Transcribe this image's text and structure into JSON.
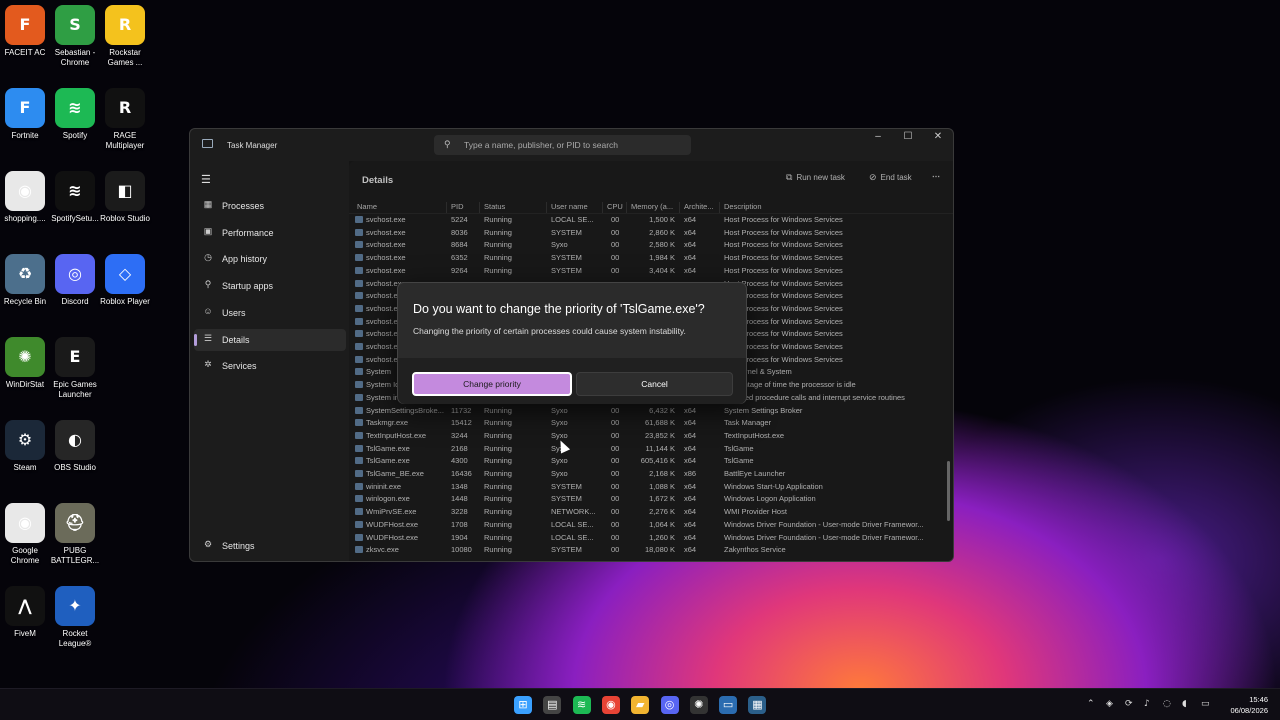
{
  "desktop_icons": [
    {
      "label": "FACEIT AC",
      "icon": "faceit-icon",
      "color": "#e35a1e",
      "glyph": "F"
    },
    {
      "label": "Sebastian - Chrome",
      "icon": "chrome-profile-icon",
      "color": "#2f9e44",
      "glyph": "S"
    },
    {
      "label": "Rockstar Games ...",
      "icon": "rockstar-icon",
      "color": "#f4c21d",
      "glyph": "R"
    },
    {
      "label": "Fortnite",
      "icon": "fortnite-icon",
      "color": "#2d8cf0",
      "glyph": "F"
    },
    {
      "label": "Spotify",
      "icon": "spotify-icon",
      "color": "#1db954",
      "glyph": "≋"
    },
    {
      "label": "RAGE Multiplayer",
      "icon": "rage-mp-icon",
      "color": "#111111",
      "glyph": "R"
    },
    {
      "label": "shopping....",
      "icon": "chrome-icon",
      "color": "#e8e8e8",
      "glyph": "◉"
    },
    {
      "label": "SpotifySetu...",
      "icon": "spotify-setup-icon",
      "color": "#101010",
      "glyph": "≋"
    },
    {
      "label": "Roblox Studio",
      "icon": "roblox-studio-icon",
      "color": "#1b1b1b",
      "glyph": "◧"
    },
    {
      "label": "Recycle Bin",
      "icon": "recycle-bin-icon",
      "color": "#4c6f8c",
      "glyph": "♻"
    },
    {
      "label": "Discord",
      "icon": "discord-icon",
      "color": "#5865f2",
      "glyph": "◎"
    },
    {
      "label": "Roblox Player",
      "icon": "roblox-player-icon",
      "color": "#2d6ef5",
      "glyph": "◇"
    },
    {
      "label": "WinDirStat",
      "icon": "windirstat-icon",
      "color": "#3f8a2c",
      "glyph": "✺"
    },
    {
      "label": "Epic Games Launcher",
      "icon": "epic-games-icon",
      "color": "#1a1a1a",
      "glyph": "E"
    },
    {
      "label": "Steam",
      "icon": "steam-icon",
      "color": "#1b2838",
      "glyph": "⚙"
    },
    {
      "label": "OBS Studio",
      "icon": "obs-icon",
      "color": "#262626",
      "glyph": "◐"
    },
    {
      "label": "Google Chrome",
      "icon": "chrome-icon",
      "color": "#e8e8e8",
      "glyph": "◉"
    },
    {
      "label": "PUBG BATTLEGR...",
      "icon": "pubg-icon",
      "color": "#6b6b5a",
      "glyph": "⛑"
    },
    {
      "label": "FiveM",
      "icon": "fivem-icon",
      "color": "#111111",
      "glyph": "⋀"
    },
    {
      "label": "Rocket League®",
      "icon": "rocket-league-icon",
      "color": "#1f5fbf",
      "glyph": "✦"
    }
  ],
  "task_manager": {
    "title": "Task Manager",
    "search_placeholder": "Type a name, publisher, or PID to search",
    "nav": [
      {
        "label": "Processes",
        "icon": "processes-icon",
        "glyph": "▦"
      },
      {
        "label": "Performance",
        "icon": "performance-icon",
        "glyph": "▣"
      },
      {
        "label": "App history",
        "icon": "app-history-icon",
        "glyph": "◷"
      },
      {
        "label": "Startup apps",
        "icon": "startup-apps-icon",
        "glyph": "⚲"
      },
      {
        "label": "Users",
        "icon": "users-icon",
        "glyph": "☺"
      },
      {
        "label": "Details",
        "icon": "details-icon",
        "glyph": "☰"
      },
      {
        "label": "Services",
        "icon": "services-icon",
        "glyph": "✲"
      }
    ],
    "settings_label": "Settings",
    "page_title": "Details",
    "run_task_label": "Run new task",
    "end_task_label": "End task",
    "columns": [
      "Name",
      "PID",
      "Status",
      "User name",
      "CPU",
      "Memory (a...",
      "Archite...",
      "Description"
    ],
    "rows": [
      [
        "svchost.exe",
        "5224",
        "Running",
        "LOCAL SE...",
        "00",
        "1,500 K",
        "x64",
        "Host Process for Windows Services"
      ],
      [
        "svchost.exe",
        "8036",
        "Running",
        "SYSTEM",
        "00",
        "2,860 K",
        "x64",
        "Host Process for Windows Services"
      ],
      [
        "svchost.exe",
        "8684",
        "Running",
        "Syxo",
        "00",
        "2,580 K",
        "x64",
        "Host Process for Windows Services"
      ],
      [
        "svchost.exe",
        "6352",
        "Running",
        "SYSTEM",
        "00",
        "1,984 K",
        "x64",
        "Host Process for Windows Services"
      ],
      [
        "svchost.exe",
        "9264",
        "Running",
        "SYSTEM",
        "00",
        "3,404 K",
        "x64",
        "Host Process for Windows Services"
      ],
      [
        "svchost.exe",
        "",
        "",
        "",
        "",
        "",
        "",
        "Host Process for Windows Services"
      ],
      [
        "svchost.exe",
        "",
        "",
        "",
        "",
        "",
        "",
        "Host Process for Windows Services"
      ],
      [
        "svchost.exe",
        "",
        "",
        "",
        "",
        "",
        "",
        "Host Process for Windows Services"
      ],
      [
        "svchost.exe",
        "",
        "",
        "",
        "",
        "",
        "",
        "Host Process for Windows Services"
      ],
      [
        "svchost.exe",
        "",
        "",
        "",
        "",
        "",
        "",
        "Host Process for Windows Services"
      ],
      [
        "svchost.exe",
        "",
        "",
        "",
        "",
        "",
        "",
        "Host Process for Windows Services"
      ],
      [
        "svchost.exe",
        "",
        "",
        "",
        "",
        "",
        "",
        "Host Process for Windows Services"
      ],
      [
        "System",
        "",
        "",
        "",
        "",
        "",
        "",
        "NT Kernel & System"
      ],
      [
        "System Idle Process",
        "",
        "",
        "",
        "",
        "",
        "",
        "Percentage of time the processor is idle"
      ],
      [
        "System interrupts",
        "",
        "",
        "",
        "",
        "",
        "",
        "Deferred procedure calls and interrupt service routines"
      ],
      [
        "SystemSettingsBroke...",
        "11732",
        "Running",
        "Syxo",
        "00",
        "6,432 K",
        "x64",
        "System Settings Broker"
      ],
      [
        "Taskmgr.exe",
        "15412",
        "Running",
        "Syxo",
        "00",
        "61,688 K",
        "x64",
        "Task Manager"
      ],
      [
        "TextInputHost.exe",
        "3244",
        "Running",
        "Syxo",
        "00",
        "23,852 K",
        "x64",
        "TextInputHost.exe"
      ],
      [
        "TslGame.exe",
        "2168",
        "Running",
        "Syxo",
        "00",
        "11,144 K",
        "x64",
        "TslGame"
      ],
      [
        "TslGame.exe",
        "4300",
        "Running",
        "Syxo",
        "00",
        "605,416 K",
        "x64",
        "TslGame"
      ],
      [
        "TslGame_BE.exe",
        "16436",
        "Running",
        "Syxo",
        "00",
        "2,168 K",
        "x86",
        "BattlEye Launcher"
      ],
      [
        "wininit.exe",
        "1348",
        "Running",
        "SYSTEM",
        "00",
        "1,088 K",
        "x64",
        "Windows Start-Up Application"
      ],
      [
        "winlogon.exe",
        "1448",
        "Running",
        "SYSTEM",
        "00",
        "1,672 K",
        "x64",
        "Windows Logon Application"
      ],
      [
        "WmiPrvSE.exe",
        "3228",
        "Running",
        "NETWORK...",
        "00",
        "2,276 K",
        "x64",
        "WMI Provider Host"
      ],
      [
        "WUDFHost.exe",
        "1708",
        "Running",
        "LOCAL SE...",
        "00",
        "1,064 K",
        "x64",
        "Windows Driver Foundation - User-mode Driver Framewor..."
      ],
      [
        "WUDFHost.exe",
        "1904",
        "Running",
        "LOCAL SE...",
        "00",
        "1,260 K",
        "x64",
        "Windows Driver Foundation - User-mode Driver Framewor..."
      ],
      [
        "zksvc.exe",
        "10080",
        "Running",
        "SYSTEM",
        "00",
        "18,080 K",
        "x64",
        "Zakynthos Service"
      ]
    ]
  },
  "dialog": {
    "title": "Do you want to change the priority of 'TslGame.exe'?",
    "message": "Changing the priority of certain processes could cause system instability.",
    "confirm_label": "Change priority",
    "cancel_label": "Cancel"
  },
  "taskbar": {
    "apps": [
      {
        "icon": "start-icon",
        "glyph": "⊞",
        "color": "#3aa0ff"
      },
      {
        "icon": "store-icon",
        "glyph": "▤",
        "color": "#444"
      },
      {
        "icon": "spotify-icon",
        "glyph": "≋",
        "color": "#1db954"
      },
      {
        "icon": "chrome-icon",
        "glyph": "◉",
        "color": "#e84335"
      },
      {
        "icon": "file-explorer-icon",
        "glyph": "▰",
        "color": "#f2b431"
      },
      {
        "icon": "discord-icon",
        "glyph": "◎",
        "color": "#5865f2"
      },
      {
        "icon": "chatgpt-icon",
        "glyph": "✺",
        "color": "#333"
      },
      {
        "icon": "notepad-icon",
        "glyph": "▭",
        "color": "#2b6cb0"
      },
      {
        "icon": "task-manager-icon",
        "glyph": "▦",
        "color": "#2b5f8a"
      }
    ],
    "tray_icons": [
      "chevron-up-icon",
      "steam-tray-icon",
      "sync-icon",
      "mic-icon",
      "network-icon",
      "volume-icon",
      "battery-icon"
    ],
    "time": "15:46",
    "date": "06/08/2026"
  }
}
